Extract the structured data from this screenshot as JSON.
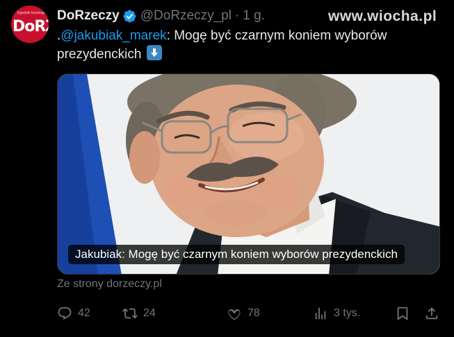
{
  "watermark": "www.wiocha.pl",
  "post": {
    "avatar": {
      "text": "DoRZEC",
      "small_text": "tygodnik lisickiego"
    },
    "author_name": "DoRzeczy",
    "handle": "@DoRzeczy_pl",
    "separator": "·",
    "time": "1 g.",
    "text_prefix": ".",
    "mention": "@jakubiak_marek",
    "text_body": ": Mogę być czarnym koniem wyborów prezydenckich",
    "emoji": "down-arrow-emoji",
    "card": {
      "caption": "Jakubiak: Mogę być czarnym koniem wyborów prezydenckich",
      "source": "Ze strony dorzeczy.pl"
    },
    "actions": {
      "replies": "42",
      "reposts": "24",
      "likes": "78",
      "views": "3 tys."
    }
  },
  "colors": {
    "background": "#000000",
    "text": "#e7e9ea",
    "muted": "#71767b",
    "accent": "#1d9bf0",
    "avatar": "#c8102e"
  },
  "icons": [
    "verified-badge-icon",
    "reply-icon",
    "repost-icon",
    "like-icon",
    "views-icon",
    "bookmark-icon",
    "share-icon"
  ]
}
